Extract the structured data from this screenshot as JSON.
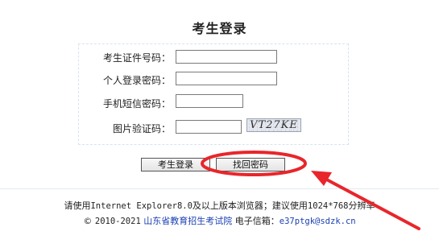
{
  "page": {
    "title": "考生登录"
  },
  "form": {
    "id_label": "考生证件号码：",
    "id_value": "",
    "personal_pw_label": "个人登录密码：",
    "personal_pw_value": "",
    "sms_label": "手机短信密码：",
    "sms_value": "",
    "captcha_label": "图片验证码：",
    "captcha_value": "",
    "captcha_image_text": "VT27KE"
  },
  "buttons": {
    "login": "考生登录",
    "recover": "找回密码"
  },
  "footer": {
    "line1_a": "请使用",
    "line1_b": "Internet Explorer8.0",
    "line1_c": "及以上版本浏览器；建议使用",
    "line1_d": "1024*768",
    "line1_e": "分辨率",
    "copyright_symbol": "©",
    "years": "2010-2021",
    "org_name": "山东省教育招生考试院",
    "email_label": "电子信箱：",
    "email": "e37ptgk@sdzk.cn"
  },
  "colors": {
    "annotation": "#e8262b",
    "link": "#1a3fb3"
  }
}
